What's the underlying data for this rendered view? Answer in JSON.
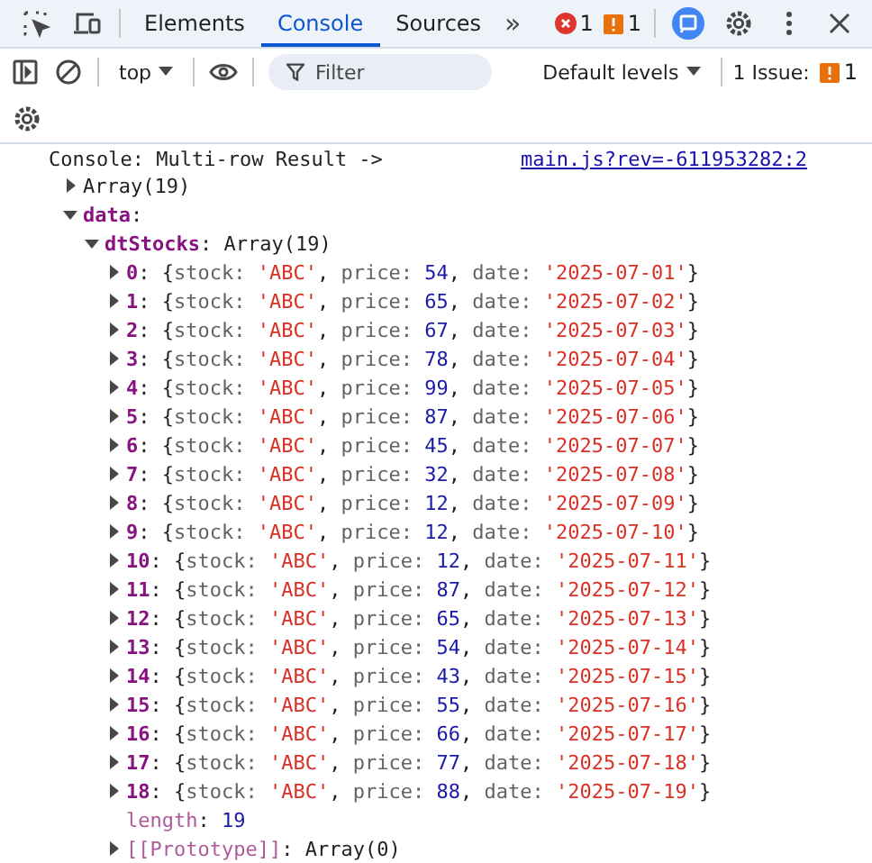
{
  "tabs": [
    {
      "label": "Elements",
      "selected": false
    },
    {
      "label": "Console",
      "selected": true
    },
    {
      "label": "Sources",
      "selected": false
    }
  ],
  "more_tabs": "»",
  "counters": [
    {
      "kind": "error",
      "count": "1"
    },
    {
      "kind": "warning",
      "count": "1"
    }
  ],
  "console_toolbar": {
    "context": "top",
    "filter": {
      "placeholder": "Filter"
    },
    "levels": "Default levels",
    "issues": {
      "label": "1 Issue:",
      "count": "1"
    }
  },
  "console": {
    "message": "Console: Multi-row Result ->",
    "source_link": "main.js?rev=-611953282:2",
    "tree": [
      {
        "tokens": [
          {
            "text": "Array(19)",
            "kind": "plain"
          }
        ],
        "expanded": false
      },
      {
        "tokens": [
          {
            "text": "data",
            "kind": "prop"
          },
          {
            "text": ":",
            "kind": "plain"
          }
        ],
        "expanded": true,
        "children": [
          {
            "tokens": [
              {
                "text": "dtStocks",
                "kind": "prop"
              },
              {
                "text": ": ",
                "kind": "plain"
              },
              {
                "text": "Array(19)",
                "kind": "plain"
              }
            ],
            "expanded": true,
            "children": [
              {
                "tokens": [
                  {
                    "text": "0",
                    "kind": "prop"
                  },
                  {
                    "text": ": {",
                    "kind": "plain"
                  },
                  {
                    "text": "stock: ",
                    "kind": "key"
                  },
                  {
                    "text": "'ABC'",
                    "kind": "string"
                  },
                  {
                    "text": ", ",
                    "kind": "plain"
                  },
                  {
                    "text": "price: ",
                    "kind": "key"
                  },
                  {
                    "text": "54",
                    "kind": "number"
                  },
                  {
                    "text": ", ",
                    "kind": "plain"
                  },
                  {
                    "text": "date: ",
                    "kind": "key"
                  },
                  {
                    "text": "'2025-07-01'",
                    "kind": "string"
                  },
                  {
                    "text": "}",
                    "kind": "plain"
                  }
                ],
                "expanded": false
              },
              {
                "tokens": [
                  {
                    "text": "1",
                    "kind": "prop"
                  },
                  {
                    "text": ": {",
                    "kind": "plain"
                  },
                  {
                    "text": "stock: ",
                    "kind": "key"
                  },
                  {
                    "text": "'ABC'",
                    "kind": "string"
                  },
                  {
                    "text": ", ",
                    "kind": "plain"
                  },
                  {
                    "text": "price: ",
                    "kind": "key"
                  },
                  {
                    "text": "65",
                    "kind": "number"
                  },
                  {
                    "text": ", ",
                    "kind": "plain"
                  },
                  {
                    "text": "date: ",
                    "kind": "key"
                  },
                  {
                    "text": "'2025-07-02'",
                    "kind": "string"
                  },
                  {
                    "text": "}",
                    "kind": "plain"
                  }
                ],
                "expanded": false
              },
              {
                "tokens": [
                  {
                    "text": "2",
                    "kind": "prop"
                  },
                  {
                    "text": ": {",
                    "kind": "plain"
                  },
                  {
                    "text": "stock: ",
                    "kind": "key"
                  },
                  {
                    "text": "'ABC'",
                    "kind": "string"
                  },
                  {
                    "text": ", ",
                    "kind": "plain"
                  },
                  {
                    "text": "price: ",
                    "kind": "key"
                  },
                  {
                    "text": "67",
                    "kind": "number"
                  },
                  {
                    "text": ", ",
                    "kind": "plain"
                  },
                  {
                    "text": "date: ",
                    "kind": "key"
                  },
                  {
                    "text": "'2025-07-03'",
                    "kind": "string"
                  },
                  {
                    "text": "}",
                    "kind": "plain"
                  }
                ],
                "expanded": false
              },
              {
                "tokens": [
                  {
                    "text": "3",
                    "kind": "prop"
                  },
                  {
                    "text": ": {",
                    "kind": "plain"
                  },
                  {
                    "text": "stock: ",
                    "kind": "key"
                  },
                  {
                    "text": "'ABC'",
                    "kind": "string"
                  },
                  {
                    "text": ", ",
                    "kind": "plain"
                  },
                  {
                    "text": "price: ",
                    "kind": "key"
                  },
                  {
                    "text": "78",
                    "kind": "number"
                  },
                  {
                    "text": ", ",
                    "kind": "plain"
                  },
                  {
                    "text": "date: ",
                    "kind": "key"
                  },
                  {
                    "text": "'2025-07-04'",
                    "kind": "string"
                  },
                  {
                    "text": "}",
                    "kind": "plain"
                  }
                ],
                "expanded": false
              },
              {
                "tokens": [
                  {
                    "text": "4",
                    "kind": "prop"
                  },
                  {
                    "text": ": {",
                    "kind": "plain"
                  },
                  {
                    "text": "stock: ",
                    "kind": "key"
                  },
                  {
                    "text": "'ABC'",
                    "kind": "string"
                  },
                  {
                    "text": ", ",
                    "kind": "plain"
                  },
                  {
                    "text": "price: ",
                    "kind": "key"
                  },
                  {
                    "text": "99",
                    "kind": "number"
                  },
                  {
                    "text": ", ",
                    "kind": "plain"
                  },
                  {
                    "text": "date: ",
                    "kind": "key"
                  },
                  {
                    "text": "'2025-07-05'",
                    "kind": "string"
                  },
                  {
                    "text": "}",
                    "kind": "plain"
                  }
                ],
                "expanded": false
              },
              {
                "tokens": [
                  {
                    "text": "5",
                    "kind": "prop"
                  },
                  {
                    "text": ": {",
                    "kind": "plain"
                  },
                  {
                    "text": "stock: ",
                    "kind": "key"
                  },
                  {
                    "text": "'ABC'",
                    "kind": "string"
                  },
                  {
                    "text": ", ",
                    "kind": "plain"
                  },
                  {
                    "text": "price: ",
                    "kind": "key"
                  },
                  {
                    "text": "87",
                    "kind": "number"
                  },
                  {
                    "text": ", ",
                    "kind": "plain"
                  },
                  {
                    "text": "date: ",
                    "kind": "key"
                  },
                  {
                    "text": "'2025-07-06'",
                    "kind": "string"
                  },
                  {
                    "text": "}",
                    "kind": "plain"
                  }
                ],
                "expanded": false
              },
              {
                "tokens": [
                  {
                    "text": "6",
                    "kind": "prop"
                  },
                  {
                    "text": ": {",
                    "kind": "plain"
                  },
                  {
                    "text": "stock: ",
                    "kind": "key"
                  },
                  {
                    "text": "'ABC'",
                    "kind": "string"
                  },
                  {
                    "text": ", ",
                    "kind": "plain"
                  },
                  {
                    "text": "price: ",
                    "kind": "key"
                  },
                  {
                    "text": "45",
                    "kind": "number"
                  },
                  {
                    "text": ", ",
                    "kind": "plain"
                  },
                  {
                    "text": "date: ",
                    "kind": "key"
                  },
                  {
                    "text": "'2025-07-07'",
                    "kind": "string"
                  },
                  {
                    "text": "}",
                    "kind": "plain"
                  }
                ],
                "expanded": false
              },
              {
                "tokens": [
                  {
                    "text": "7",
                    "kind": "prop"
                  },
                  {
                    "text": ": {",
                    "kind": "plain"
                  },
                  {
                    "text": "stock: ",
                    "kind": "key"
                  },
                  {
                    "text": "'ABC'",
                    "kind": "string"
                  },
                  {
                    "text": ", ",
                    "kind": "plain"
                  },
                  {
                    "text": "price: ",
                    "kind": "key"
                  },
                  {
                    "text": "32",
                    "kind": "number"
                  },
                  {
                    "text": ", ",
                    "kind": "plain"
                  },
                  {
                    "text": "date: ",
                    "kind": "key"
                  },
                  {
                    "text": "'2025-07-08'",
                    "kind": "string"
                  },
                  {
                    "text": "}",
                    "kind": "plain"
                  }
                ],
                "expanded": false
              },
              {
                "tokens": [
                  {
                    "text": "8",
                    "kind": "prop"
                  },
                  {
                    "text": ": {",
                    "kind": "plain"
                  },
                  {
                    "text": "stock: ",
                    "kind": "key"
                  },
                  {
                    "text": "'ABC'",
                    "kind": "string"
                  },
                  {
                    "text": ", ",
                    "kind": "plain"
                  },
                  {
                    "text": "price: ",
                    "kind": "key"
                  },
                  {
                    "text": "12",
                    "kind": "number"
                  },
                  {
                    "text": ", ",
                    "kind": "plain"
                  },
                  {
                    "text": "date: ",
                    "kind": "key"
                  },
                  {
                    "text": "'2025-07-09'",
                    "kind": "string"
                  },
                  {
                    "text": "}",
                    "kind": "plain"
                  }
                ],
                "expanded": false
              },
              {
                "tokens": [
                  {
                    "text": "9",
                    "kind": "prop"
                  },
                  {
                    "text": ": {",
                    "kind": "plain"
                  },
                  {
                    "text": "stock: ",
                    "kind": "key"
                  },
                  {
                    "text": "'ABC'",
                    "kind": "string"
                  },
                  {
                    "text": ", ",
                    "kind": "plain"
                  },
                  {
                    "text": "price: ",
                    "kind": "key"
                  },
                  {
                    "text": "12",
                    "kind": "number"
                  },
                  {
                    "text": ", ",
                    "kind": "plain"
                  },
                  {
                    "text": "date: ",
                    "kind": "key"
                  },
                  {
                    "text": "'2025-07-10'",
                    "kind": "string"
                  },
                  {
                    "text": "}",
                    "kind": "plain"
                  }
                ],
                "expanded": false
              },
              {
                "tokens": [
                  {
                    "text": "10",
                    "kind": "prop"
                  },
                  {
                    "text": ": {",
                    "kind": "plain"
                  },
                  {
                    "text": "stock: ",
                    "kind": "key"
                  },
                  {
                    "text": "'ABC'",
                    "kind": "string"
                  },
                  {
                    "text": ", ",
                    "kind": "plain"
                  },
                  {
                    "text": "price: ",
                    "kind": "key"
                  },
                  {
                    "text": "12",
                    "kind": "number"
                  },
                  {
                    "text": ", ",
                    "kind": "plain"
                  },
                  {
                    "text": "date: ",
                    "kind": "key"
                  },
                  {
                    "text": "'2025-07-11'",
                    "kind": "string"
                  },
                  {
                    "text": "}",
                    "kind": "plain"
                  }
                ],
                "expanded": false
              },
              {
                "tokens": [
                  {
                    "text": "11",
                    "kind": "prop"
                  },
                  {
                    "text": ": {",
                    "kind": "plain"
                  },
                  {
                    "text": "stock: ",
                    "kind": "key"
                  },
                  {
                    "text": "'ABC'",
                    "kind": "string"
                  },
                  {
                    "text": ", ",
                    "kind": "plain"
                  },
                  {
                    "text": "price: ",
                    "kind": "key"
                  },
                  {
                    "text": "87",
                    "kind": "number"
                  },
                  {
                    "text": ", ",
                    "kind": "plain"
                  },
                  {
                    "text": "date: ",
                    "kind": "key"
                  },
                  {
                    "text": "'2025-07-12'",
                    "kind": "string"
                  },
                  {
                    "text": "}",
                    "kind": "plain"
                  }
                ],
                "expanded": false
              },
              {
                "tokens": [
                  {
                    "text": "12",
                    "kind": "prop"
                  },
                  {
                    "text": ": {",
                    "kind": "plain"
                  },
                  {
                    "text": "stock: ",
                    "kind": "key"
                  },
                  {
                    "text": "'ABC'",
                    "kind": "string"
                  },
                  {
                    "text": ", ",
                    "kind": "plain"
                  },
                  {
                    "text": "price: ",
                    "kind": "key"
                  },
                  {
                    "text": "65",
                    "kind": "number"
                  },
                  {
                    "text": ", ",
                    "kind": "plain"
                  },
                  {
                    "text": "date: ",
                    "kind": "key"
                  },
                  {
                    "text": "'2025-07-13'",
                    "kind": "string"
                  },
                  {
                    "text": "}",
                    "kind": "plain"
                  }
                ],
                "expanded": false
              },
              {
                "tokens": [
                  {
                    "text": "13",
                    "kind": "prop"
                  },
                  {
                    "text": ": {",
                    "kind": "plain"
                  },
                  {
                    "text": "stock: ",
                    "kind": "key"
                  },
                  {
                    "text": "'ABC'",
                    "kind": "string"
                  },
                  {
                    "text": ", ",
                    "kind": "plain"
                  },
                  {
                    "text": "price: ",
                    "kind": "key"
                  },
                  {
                    "text": "54",
                    "kind": "number"
                  },
                  {
                    "text": ", ",
                    "kind": "plain"
                  },
                  {
                    "text": "date: ",
                    "kind": "key"
                  },
                  {
                    "text": "'2025-07-14'",
                    "kind": "string"
                  },
                  {
                    "text": "}",
                    "kind": "plain"
                  }
                ],
                "expanded": false
              },
              {
                "tokens": [
                  {
                    "text": "14",
                    "kind": "prop"
                  },
                  {
                    "text": ": {",
                    "kind": "plain"
                  },
                  {
                    "text": "stock: ",
                    "kind": "key"
                  },
                  {
                    "text": "'ABC'",
                    "kind": "string"
                  },
                  {
                    "text": ", ",
                    "kind": "plain"
                  },
                  {
                    "text": "price: ",
                    "kind": "key"
                  },
                  {
                    "text": "43",
                    "kind": "number"
                  },
                  {
                    "text": ", ",
                    "kind": "plain"
                  },
                  {
                    "text": "date: ",
                    "kind": "key"
                  },
                  {
                    "text": "'2025-07-15'",
                    "kind": "string"
                  },
                  {
                    "text": "}",
                    "kind": "plain"
                  }
                ],
                "expanded": false
              },
              {
                "tokens": [
                  {
                    "text": "15",
                    "kind": "prop"
                  },
                  {
                    "text": ": {",
                    "kind": "plain"
                  },
                  {
                    "text": "stock: ",
                    "kind": "key"
                  },
                  {
                    "text": "'ABC'",
                    "kind": "string"
                  },
                  {
                    "text": ", ",
                    "kind": "plain"
                  },
                  {
                    "text": "price: ",
                    "kind": "key"
                  },
                  {
                    "text": "55",
                    "kind": "number"
                  },
                  {
                    "text": ", ",
                    "kind": "plain"
                  },
                  {
                    "text": "date: ",
                    "kind": "key"
                  },
                  {
                    "text": "'2025-07-16'",
                    "kind": "string"
                  },
                  {
                    "text": "}",
                    "kind": "plain"
                  }
                ],
                "expanded": false
              },
              {
                "tokens": [
                  {
                    "text": "16",
                    "kind": "prop"
                  },
                  {
                    "text": ": {",
                    "kind": "plain"
                  },
                  {
                    "text": "stock: ",
                    "kind": "key"
                  },
                  {
                    "text": "'ABC'",
                    "kind": "string"
                  },
                  {
                    "text": ", ",
                    "kind": "plain"
                  },
                  {
                    "text": "price: ",
                    "kind": "key"
                  },
                  {
                    "text": "66",
                    "kind": "number"
                  },
                  {
                    "text": ", ",
                    "kind": "plain"
                  },
                  {
                    "text": "date: ",
                    "kind": "key"
                  },
                  {
                    "text": "'2025-07-17'",
                    "kind": "string"
                  },
                  {
                    "text": "}",
                    "kind": "plain"
                  }
                ],
                "expanded": false
              },
              {
                "tokens": [
                  {
                    "text": "17",
                    "kind": "prop"
                  },
                  {
                    "text": ": {",
                    "kind": "plain"
                  },
                  {
                    "text": "stock: ",
                    "kind": "key"
                  },
                  {
                    "text": "'ABC'",
                    "kind": "string"
                  },
                  {
                    "text": ", ",
                    "kind": "plain"
                  },
                  {
                    "text": "price: ",
                    "kind": "key"
                  },
                  {
                    "text": "77",
                    "kind": "number"
                  },
                  {
                    "text": ", ",
                    "kind": "plain"
                  },
                  {
                    "text": "date: ",
                    "kind": "key"
                  },
                  {
                    "text": "'2025-07-18'",
                    "kind": "string"
                  },
                  {
                    "text": "}",
                    "kind": "plain"
                  }
                ],
                "expanded": false
              },
              {
                "tokens": [
                  {
                    "text": "18",
                    "kind": "prop"
                  },
                  {
                    "text": ": {",
                    "kind": "plain"
                  },
                  {
                    "text": "stock: ",
                    "kind": "key"
                  },
                  {
                    "text": "'ABC'",
                    "kind": "string"
                  },
                  {
                    "text": ", ",
                    "kind": "plain"
                  },
                  {
                    "text": "price: ",
                    "kind": "key"
                  },
                  {
                    "text": "88",
                    "kind": "number"
                  },
                  {
                    "text": ", ",
                    "kind": "plain"
                  },
                  {
                    "text": "date: ",
                    "kind": "key"
                  },
                  {
                    "text": "'2025-07-19'",
                    "kind": "string"
                  },
                  {
                    "text": "}",
                    "kind": "plain"
                  }
                ],
                "expanded": false
              },
              {
                "tokens": [
                  {
                    "text": "length",
                    "kind": "meta"
                  },
                  {
                    "text": ": ",
                    "kind": "plain"
                  },
                  {
                    "text": "19",
                    "kind": "number"
                  }
                ]
              },
              {
                "tokens": [
                  {
                    "text": "[[Prototype]]",
                    "kind": "meta"
                  },
                  {
                    "text": ": ",
                    "kind": "plain"
                  },
                  {
                    "text": "Array(0)",
                    "kind": "plain"
                  }
                ],
                "expanded": false
              }
            ]
          }
        ]
      }
    ]
  }
}
